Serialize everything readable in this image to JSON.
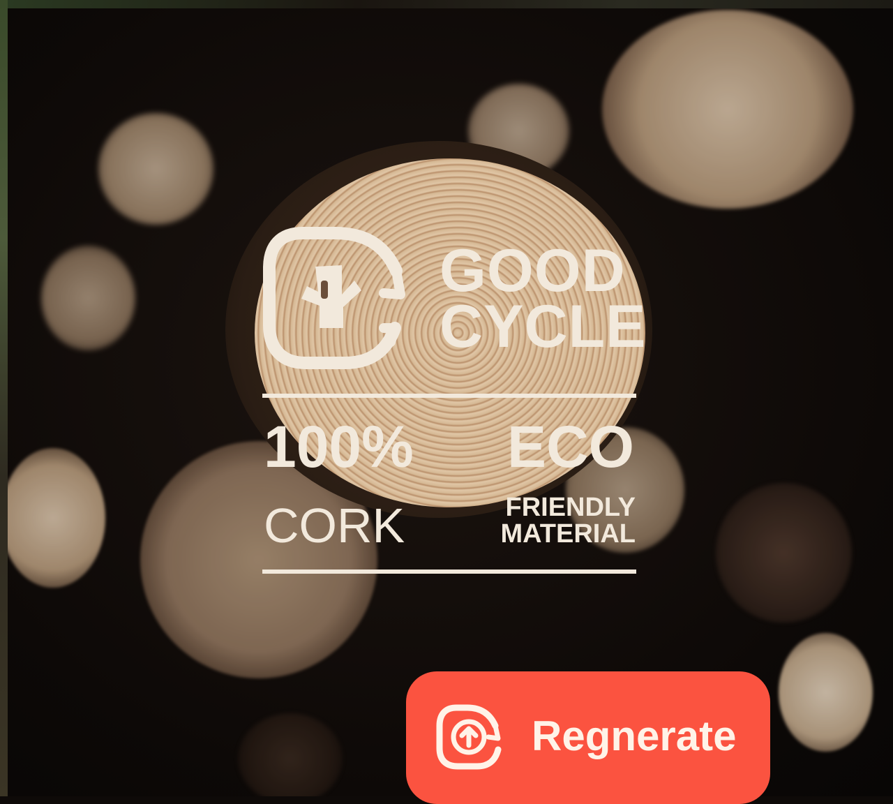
{
  "logo": {
    "brand_line1": "GOOD",
    "brand_line2": "CYCLE",
    "stat_left": "100%",
    "stat_right": "ECO",
    "sub_left": "CORK",
    "sub_right_line1": "FRIENDLY",
    "sub_right_line2": "MATERIAL",
    "icon": "recycle-tree-stump-icon",
    "color": "#f2e9dc"
  },
  "actions": {
    "regenerate_label": "Regnerate",
    "regenerate_icon": "upload-cycle-icon",
    "accent": "#fb5340"
  }
}
